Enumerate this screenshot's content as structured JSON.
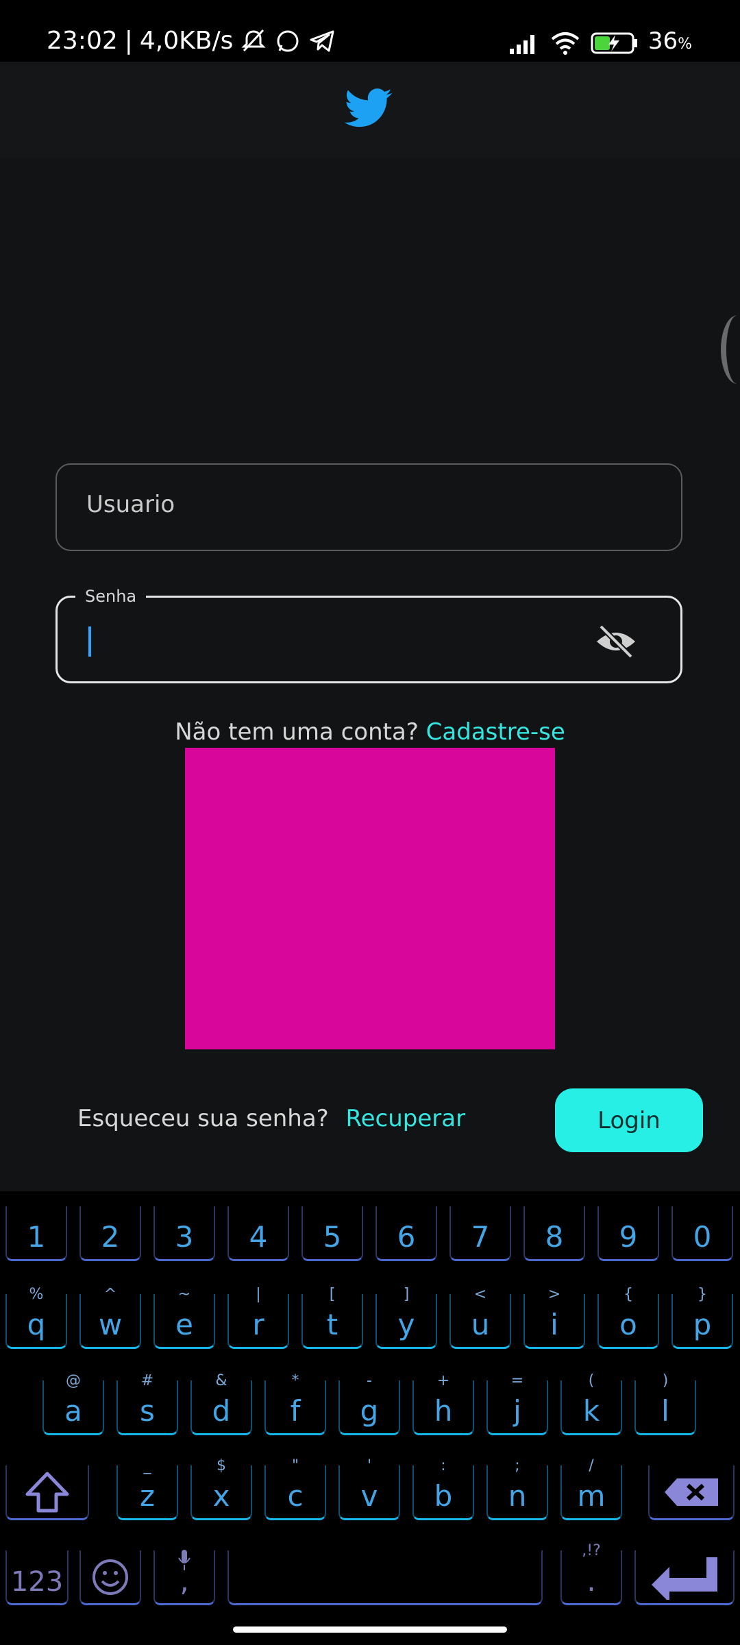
{
  "status_bar": {
    "time": "23:02",
    "separator": "|",
    "speed": "4,0KB/s",
    "battery_percent": "36",
    "percent_sign": "%"
  },
  "form": {
    "username_placeholder": "Usuario",
    "password_label": "Senha",
    "signup_prompt": "Não tem uma conta?",
    "signup_link": "Cadastre-se",
    "forgot_prompt": "Esqueceu sua senha?",
    "recover_link": "Recuperar",
    "login_button": "Login"
  },
  "colors": {
    "background": "#111314",
    "accent_cyan": "#27efe6",
    "link_cyan": "#35e6e0",
    "twitter_blue": "#1da1f2",
    "placeholder_magenta": "#d8069a"
  },
  "keyboard": {
    "row_numbers": [
      "1",
      "2",
      "3",
      "4",
      "5",
      "6",
      "7",
      "8",
      "9",
      "0"
    ],
    "row_top": [
      {
        "main": "q",
        "sub": "%"
      },
      {
        "main": "w",
        "sub": "^"
      },
      {
        "main": "e",
        "sub": "~"
      },
      {
        "main": "r",
        "sub": "|"
      },
      {
        "main": "t",
        "sub": "["
      },
      {
        "main": "y",
        "sub": "]"
      },
      {
        "main": "u",
        "sub": "<"
      },
      {
        "main": "i",
        "sub": ">"
      },
      {
        "main": "o",
        "sub": "{"
      },
      {
        "main": "p",
        "sub": "}"
      }
    ],
    "row_middle": [
      {
        "main": "a",
        "sub": "@"
      },
      {
        "main": "s",
        "sub": "#"
      },
      {
        "main": "d",
        "sub": "&"
      },
      {
        "main": "f",
        "sub": "*"
      },
      {
        "main": "g",
        "sub": "-"
      },
      {
        "main": "h",
        "sub": "+"
      },
      {
        "main": "j",
        "sub": "="
      },
      {
        "main": "k",
        "sub": "("
      },
      {
        "main": "l",
        "sub": ")"
      }
    ],
    "row_bottom": [
      {
        "main": "z",
        "sub": "_"
      },
      {
        "main": "x",
        "sub": "$"
      },
      {
        "main": "c",
        "sub": "\""
      },
      {
        "main": "v",
        "sub": "'"
      },
      {
        "main": "b",
        "sub": ":"
      },
      {
        "main": "n",
        "sub": ";"
      },
      {
        "main": "m",
        "sub": "/"
      }
    ],
    "symbols_key": "123",
    "comma_key": ",",
    "period_key": ".",
    "period_sub": ",!?"
  },
  "icons": {
    "app_logo": "twitter-bird-icon",
    "password_toggle": "eye-off-icon",
    "shift": "shift-icon",
    "backspace": "backspace-icon",
    "enter": "enter-icon",
    "emoji": "emoji-icon",
    "mic": "mic-icon"
  }
}
